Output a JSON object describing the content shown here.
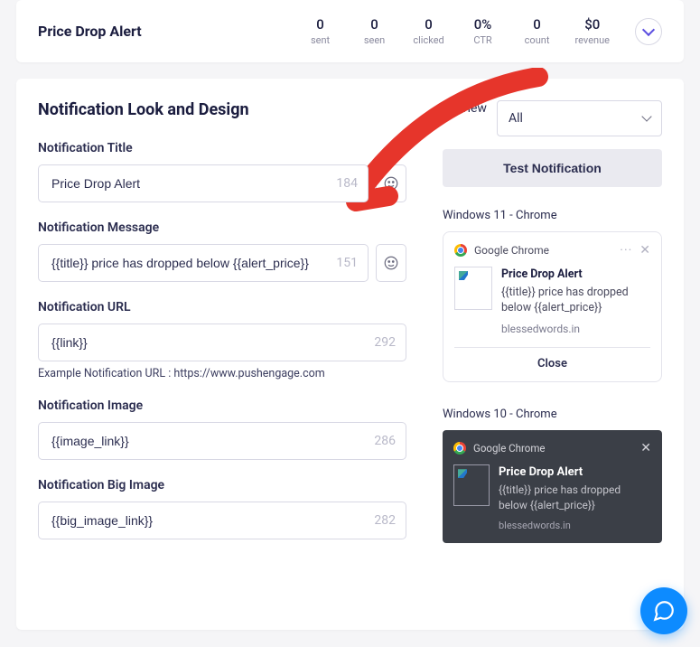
{
  "header": {
    "title": "Price Drop Alert",
    "stats": [
      {
        "value": "0",
        "label": "sent"
      },
      {
        "value": "0",
        "label": "seen"
      },
      {
        "value": "0",
        "label": "clicked"
      },
      {
        "value": "0%",
        "label": "CTR"
      },
      {
        "value": "0",
        "label": "count"
      },
      {
        "value": "$0",
        "label": "revenue"
      }
    ]
  },
  "design": {
    "heading": "Notification Look and Design",
    "title_field": {
      "label": "Notification Title",
      "value": "Price Drop Alert",
      "count": "184"
    },
    "message_field": {
      "label": "Notification Message",
      "value": "{{title}} price has dropped below {{alert_price}}",
      "count": "151"
    },
    "url_field": {
      "label": "Notification URL",
      "value": "{{link}}",
      "count": "292",
      "helper": "Example Notification URL : https://www.pushengage.com"
    },
    "image_field": {
      "label": "Notification Image",
      "value": "{{image_link}}",
      "count": "286"
    },
    "bigimage_field": {
      "label": "Notification Big Image",
      "value": "{{big_image_link}}",
      "count": "282"
    }
  },
  "preview": {
    "label": "Preview",
    "select_value": "All",
    "test_button": "Test Notification",
    "win11": {
      "os": "Windows 11 - Chrome",
      "browser": "Google Chrome",
      "title": "Price Drop Alert",
      "message": "{{title}} price has dropped below {{alert_price}}",
      "domain": "blessedwords.in",
      "close": "Close"
    },
    "win10": {
      "os": "Windows 10 - Chrome",
      "browser": "Google Chrome",
      "title": "Price Drop Alert",
      "message": "{{title}} price has dropped below {{alert_price}}",
      "domain": "blessedwords.in"
    }
  }
}
